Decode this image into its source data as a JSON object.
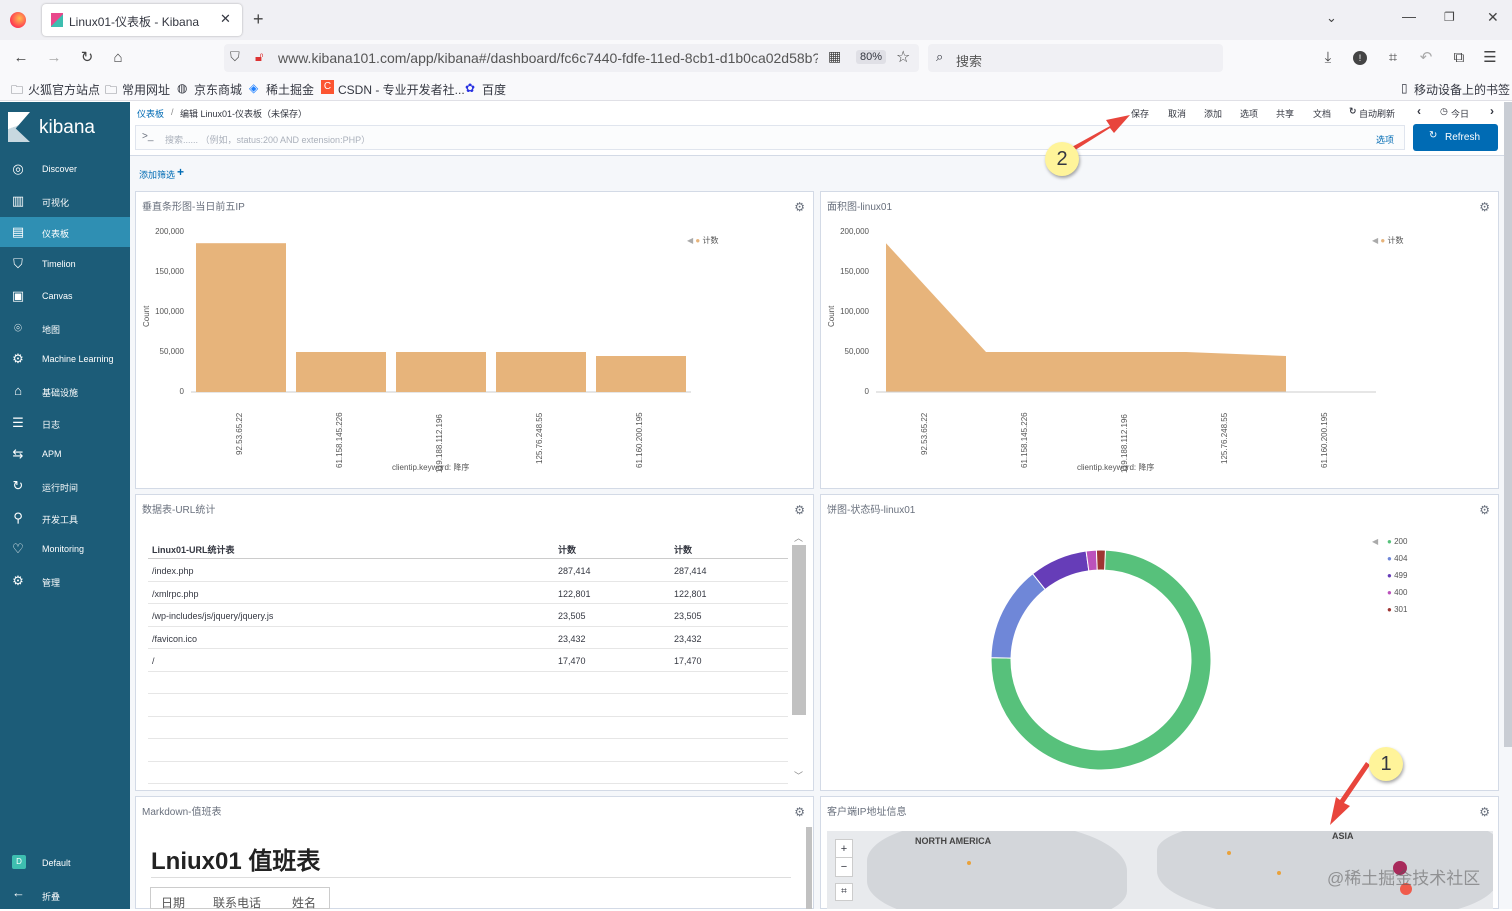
{
  "browser": {
    "tab_title": "Linux01-仪表板 - Kibana",
    "url": "www.kibana101.com/app/kibana#/dashboard/fc6c7440-fdfe-11ed-8cb1-d1b0ca02d58b?_g",
    "zoom": "80%",
    "search_placeholder": "搜索",
    "bookmarks": [
      "火狐官方站点",
      "常用网址",
      "京东商城",
      "稀土掘金",
      "CSDN - 专业开发者社...",
      "百度"
    ],
    "mobile_bookmarks": "移动设备上的书签"
  },
  "kibana": {
    "logo": "kibana",
    "nav": [
      {
        "label": "Discover",
        "icon": "compass-icon"
      },
      {
        "label": "可视化",
        "icon": "chart-icon"
      },
      {
        "label": "仪表板",
        "icon": "dashboard-icon",
        "active": true
      },
      {
        "label": "Timelion",
        "icon": "shield-icon"
      },
      {
        "label": "Canvas",
        "icon": "canvas-icon"
      },
      {
        "label": "地图",
        "icon": "map-icon"
      },
      {
        "label": "Machine Learning",
        "icon": "ml-icon"
      },
      {
        "label": "基础设施",
        "icon": "infra-icon"
      },
      {
        "label": "日志",
        "icon": "logs-icon"
      },
      {
        "label": "APM",
        "icon": "apm-icon"
      },
      {
        "label": "运行时间",
        "icon": "uptime-icon"
      },
      {
        "label": "开发工具",
        "icon": "wrench-icon"
      },
      {
        "label": "Monitoring",
        "icon": "monitoring-icon"
      },
      {
        "label": "管理",
        "icon": "gear-icon"
      }
    ],
    "space": {
      "badge": "D",
      "label": "Default"
    },
    "collapse": "折叠",
    "breadcrumb": {
      "root": "仪表板",
      "sep": "/",
      "current": "编辑 Linux01-仪表板（未保存）"
    },
    "top_menu": [
      "保存",
      "取消",
      "添加",
      "选项",
      "共享",
      "文档",
      "自动刷新"
    ],
    "time_label": "今日",
    "query_placeholder": "搜索...... （例如，status:200 AND extension:PHP）",
    "options_link": "选项",
    "refresh_label": "Refresh",
    "add_filter": "添加筛选"
  },
  "panels": {
    "bar": {
      "title": "垂直条形图-当日前五IP",
      "legend": "计数",
      "ylabel": "Count",
      "xlabel": "clientip.keyword: 降序"
    },
    "area": {
      "title": "面积图-linux01",
      "legend": "计数",
      "ylabel": "Count",
      "xlabel": "clientip.keyword: 降序"
    },
    "table": {
      "title": "数据表-URL统计",
      "headers": [
        "Linux01-URL统计表",
        "计数",
        "计数"
      ],
      "rows": [
        [
          "/index.php",
          "287,414",
          "287,414"
        ],
        [
          "/xmlrpc.php",
          "122,801",
          "122,801"
        ],
        [
          "/wp-includes/js/jquery/jquery.js",
          "23,505",
          "23,505"
        ],
        [
          "/favicon.ico",
          "23,432",
          "23,432"
        ],
        [
          "/",
          "17,470",
          "17,470"
        ]
      ]
    },
    "pie": {
      "title": "饼图-状态码-linux01"
    },
    "markdown": {
      "title": "Markdown-值班表",
      "heading": "Lniux01 值班表",
      "columns": [
        "日期",
        "联系电话",
        "姓名"
      ]
    },
    "map": {
      "title": "客户端IP地址信息",
      "labels": [
        "NORTH AMERICA",
        "ASIA"
      ]
    }
  },
  "annotations": {
    "callout1": "1",
    "callout2": "2"
  },
  "watermark": "@稀土掘金技术社区",
  "colors": {
    "sidebar": "#1c5c78",
    "active": "#2f8fb3",
    "bar": "#e7b47b",
    "accent": "#006bb4"
  },
  "chart_data": [
    {
      "type": "bar",
      "title": "垂直条形图-当日前五IP",
      "categories": [
        "92.53.65.22",
        "61.158.145.226",
        "119.188.112.196",
        "125.76.248.55",
        "61.160.200.195"
      ],
      "series": [
        {
          "name": "计数",
          "values": [
            186000,
            50000,
            50000,
            50000,
            45000
          ]
        }
      ],
      "yticks": [
        "200,000",
        "150,000",
        "100,000",
        "50,000",
        "0"
      ],
      "ylim": [
        0,
        200000
      ],
      "xlabel": "clientip.keyword: 降序",
      "ylabel": "Count"
    },
    {
      "type": "area",
      "title": "面积图-linux01",
      "categories": [
        "92.53.65.22",
        "61.158.145.226",
        "119.188.112.196",
        "125.76.248.55",
        "61.160.200.195"
      ],
      "series": [
        {
          "name": "计数",
          "values": [
            186000,
            50000,
            50000,
            50000,
            45000
          ]
        }
      ],
      "yticks": [
        "200,000",
        "150,000",
        "100,000",
        "50,000",
        "0"
      ],
      "ylim": [
        0,
        200000
      ],
      "xlabel": "clientip.keyword: 降序",
      "ylabel": "Count"
    },
    {
      "type": "pie",
      "title": "饼图-状态码-linux01",
      "categories": [
        "200",
        "404",
        "499",
        "400",
        "301"
      ],
      "values": [
        0.747,
        0.14,
        0.085,
        0.015,
        0.013
      ],
      "colors": [
        "#57c17b",
        "#6f87d8",
        "#663db8",
        "#bc52bc",
        "#9e3533"
      ]
    }
  ]
}
